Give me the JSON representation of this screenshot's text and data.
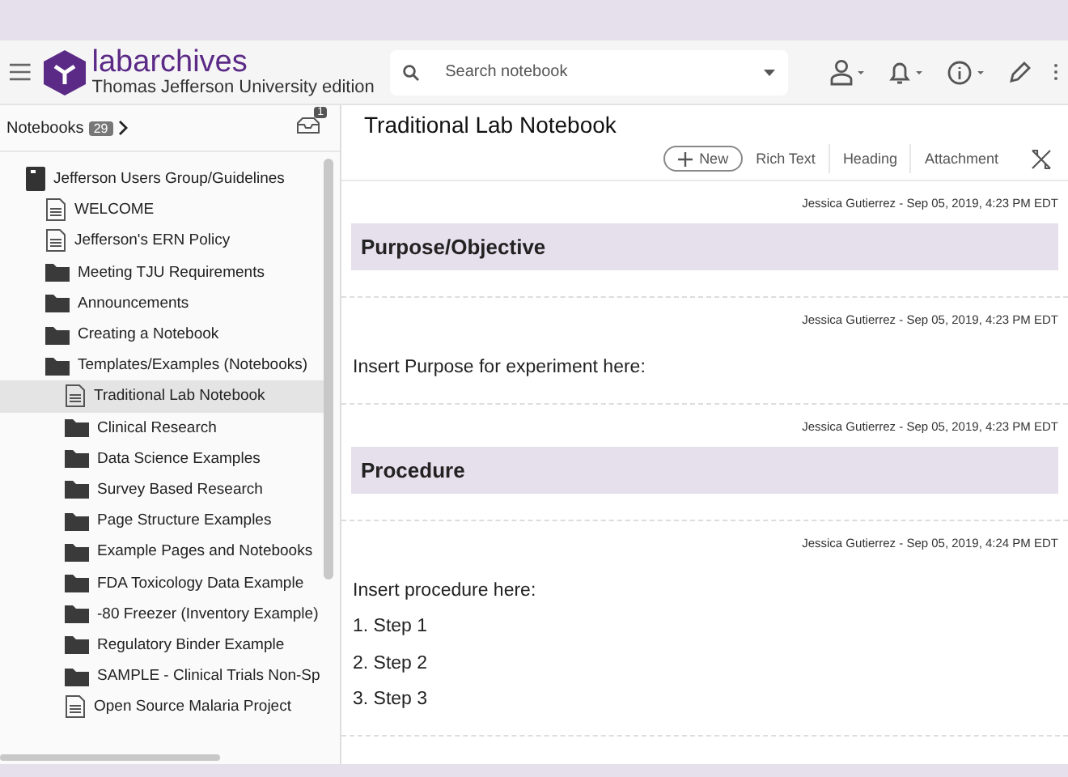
{
  "header": {
    "brand": "labarchives",
    "edition": "Thomas Jefferson University edition",
    "search": {
      "placeholder": "Search notebook"
    }
  },
  "sidebar": {
    "title": "Notebooks",
    "count": "29",
    "inbox_count": "1",
    "tree": [
      {
        "label": "Jefferson Users Group/Guidelines",
        "kind": "notebook",
        "selected": false,
        "children": [
          {
            "label": "WELCOME",
            "kind": "page",
            "selected": false
          },
          {
            "label": "Jefferson's ERN Policy",
            "kind": "page",
            "selected": false
          },
          {
            "label": "Meeting TJU Requirements",
            "kind": "folder",
            "selected": false
          },
          {
            "label": "Announcements",
            "kind": "folder",
            "selected": false
          },
          {
            "label": "Creating a Notebook",
            "kind": "folder",
            "selected": false
          },
          {
            "label": "Templates/Examples (Notebooks)",
            "kind": "folder",
            "selected": false,
            "children": [
              {
                "label": "Traditional Lab Notebook",
                "kind": "page",
                "selected": true
              },
              {
                "label": "Clinical Research",
                "kind": "folder",
                "selected": false
              },
              {
                "label": "Data Science Examples",
                "kind": "folder",
                "selected": false
              },
              {
                "label": "Survey Based Research",
                "kind": "folder",
                "selected": false
              },
              {
                "label": "Page Structure Examples",
                "kind": "folder",
                "selected": false
              },
              {
                "label": "Example Pages and Notebooks",
                "kind": "folder",
                "selected": false
              },
              {
                "label": "FDA Toxicology Data Example",
                "kind": "folder",
                "selected": false
              },
              {
                "label": "-80 Freezer (Inventory Example)",
                "kind": "folder",
                "selected": false
              },
              {
                "label": "Regulatory Binder Example",
                "kind": "folder",
                "selected": false
              },
              {
                "label": "SAMPLE - Clinical Trials Non-Sp",
                "kind": "folder",
                "selected": false
              },
              {
                "label": "Open Source Malaria Project",
                "kind": "page",
                "selected": false
              }
            ]
          }
        ]
      }
    ]
  },
  "page": {
    "title": "Traditional Lab Notebook",
    "toolbar": {
      "new": "New",
      "buttons": [
        "Rich Text",
        "Heading",
        "Attachment"
      ]
    },
    "entries": [
      {
        "kind": "heading",
        "meta": "Jessica Gutierrez - Sep 05, 2019, 4:23 PM EDT",
        "lines": [
          "Purpose/Objective"
        ]
      },
      {
        "kind": "text",
        "meta": "Jessica Gutierrez - Sep 05, 2019, 4:23 PM EDT",
        "lines": [
          "Insert Purpose for experiment here:"
        ]
      },
      {
        "kind": "heading",
        "meta": "Jessica Gutierrez - Sep 05, 2019, 4:23 PM EDT",
        "lines": [
          "Procedure"
        ]
      },
      {
        "kind": "text",
        "meta": "Jessica Gutierrez - Sep 05, 2019, 4:24 PM EDT",
        "lines": [
          "Insert procedure here:",
          "1. Step 1",
          "2. Step 2",
          "3. Step 3"
        ]
      }
    ]
  }
}
